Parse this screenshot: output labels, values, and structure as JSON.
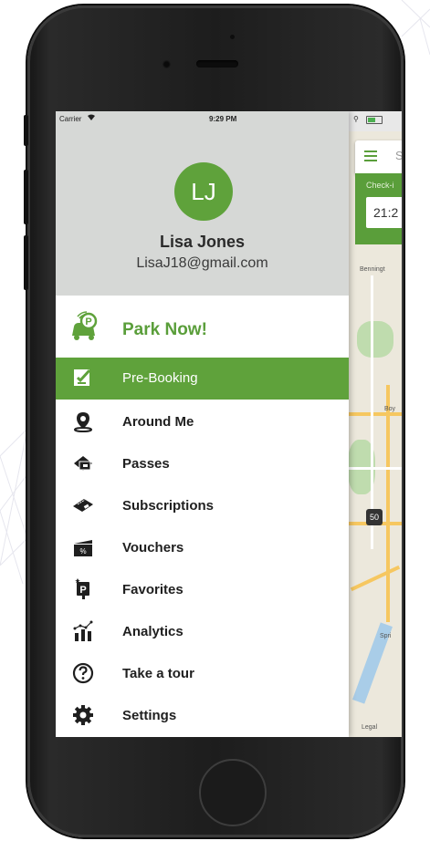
{
  "status_bar": {
    "carrier": "Carrier",
    "time": "9:29 PM"
  },
  "user": {
    "initials": "LJ",
    "name": "Lisa Jones",
    "email": "LisaJ18@gmail.com"
  },
  "park_now": {
    "label": "Park Now!",
    "icon": "car-parking-icon"
  },
  "menu": {
    "items": [
      {
        "label": "Pre-Booking",
        "icon": "calendar-check-icon",
        "active": true
      },
      {
        "label": "Around Me",
        "icon": "location-pin-icon",
        "active": false
      },
      {
        "label": "Passes",
        "icon": "passes-icon",
        "active": false
      },
      {
        "label": "Subscriptions",
        "icon": "tickets-icon",
        "active": false
      },
      {
        "label": "Vouchers",
        "icon": "voucher-icon",
        "active": false
      },
      {
        "label": "Favorites",
        "icon": "favorite-parking-icon",
        "active": false
      },
      {
        "label": "Analytics",
        "icon": "analytics-icon",
        "active": false
      },
      {
        "label": "Take a tour",
        "icon": "help-icon",
        "active": false
      },
      {
        "label": "Settings",
        "icon": "gear-icon",
        "active": false
      }
    ]
  },
  "map": {
    "search_placeholder": "Se",
    "checkin_label": "Check-i",
    "checkin_time": "21:2",
    "labels": [
      "Benningt",
      "Boy",
      "Spri",
      "Legal"
    ],
    "pin_label": "50"
  },
  "colors": {
    "accent": "#5fa23b",
    "header_bg": "#d6d8d6",
    "phone_body": "#1d1d1d"
  }
}
